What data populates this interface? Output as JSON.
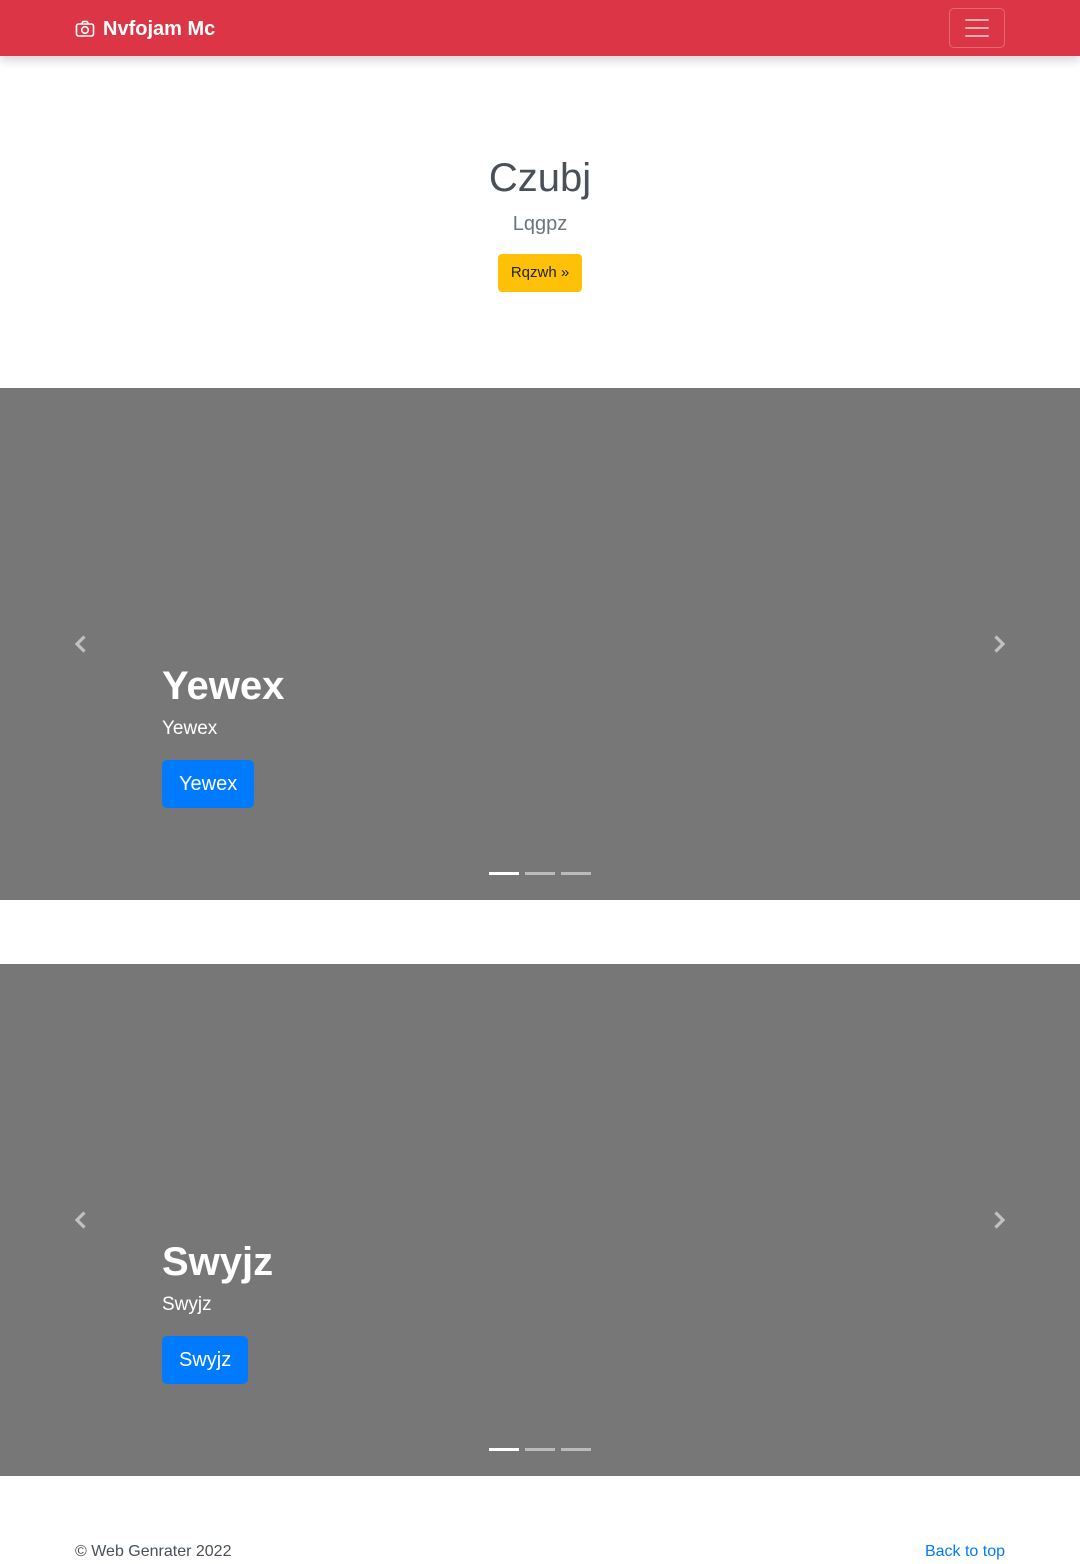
{
  "navbar": {
    "brand": "Nvfojam Mc",
    "brand_icon": "camera-icon",
    "toggler_icon": "hamburger-menu-icon",
    "background_color": "#dc3545"
  },
  "hero": {
    "title": "Czubj",
    "lead": "Lqgpz",
    "button_label": "Rqzwh »",
    "button_color": "#ffc107"
  },
  "carousels": [
    {
      "heading": "Yewex",
      "subtext": "Yewex",
      "button_label": "Yewex",
      "prev_icon": "chevron-left-icon",
      "next_icon": "chevron-right-icon",
      "indicator_count": 3,
      "active_index": 0
    },
    {
      "heading": "Swyjz",
      "subtext": "Swyjz",
      "button_label": "Swyjz",
      "prev_icon": "chevron-left-icon",
      "next_icon": "chevron-right-icon",
      "indicator_count": 3,
      "active_index": 0
    }
  ],
  "colors": {
    "carousel_background": "#777777",
    "primary_button": "#007bff"
  },
  "footer": {
    "copyright": "© Web Genrater 2022",
    "back_to_top": "Back to top"
  }
}
